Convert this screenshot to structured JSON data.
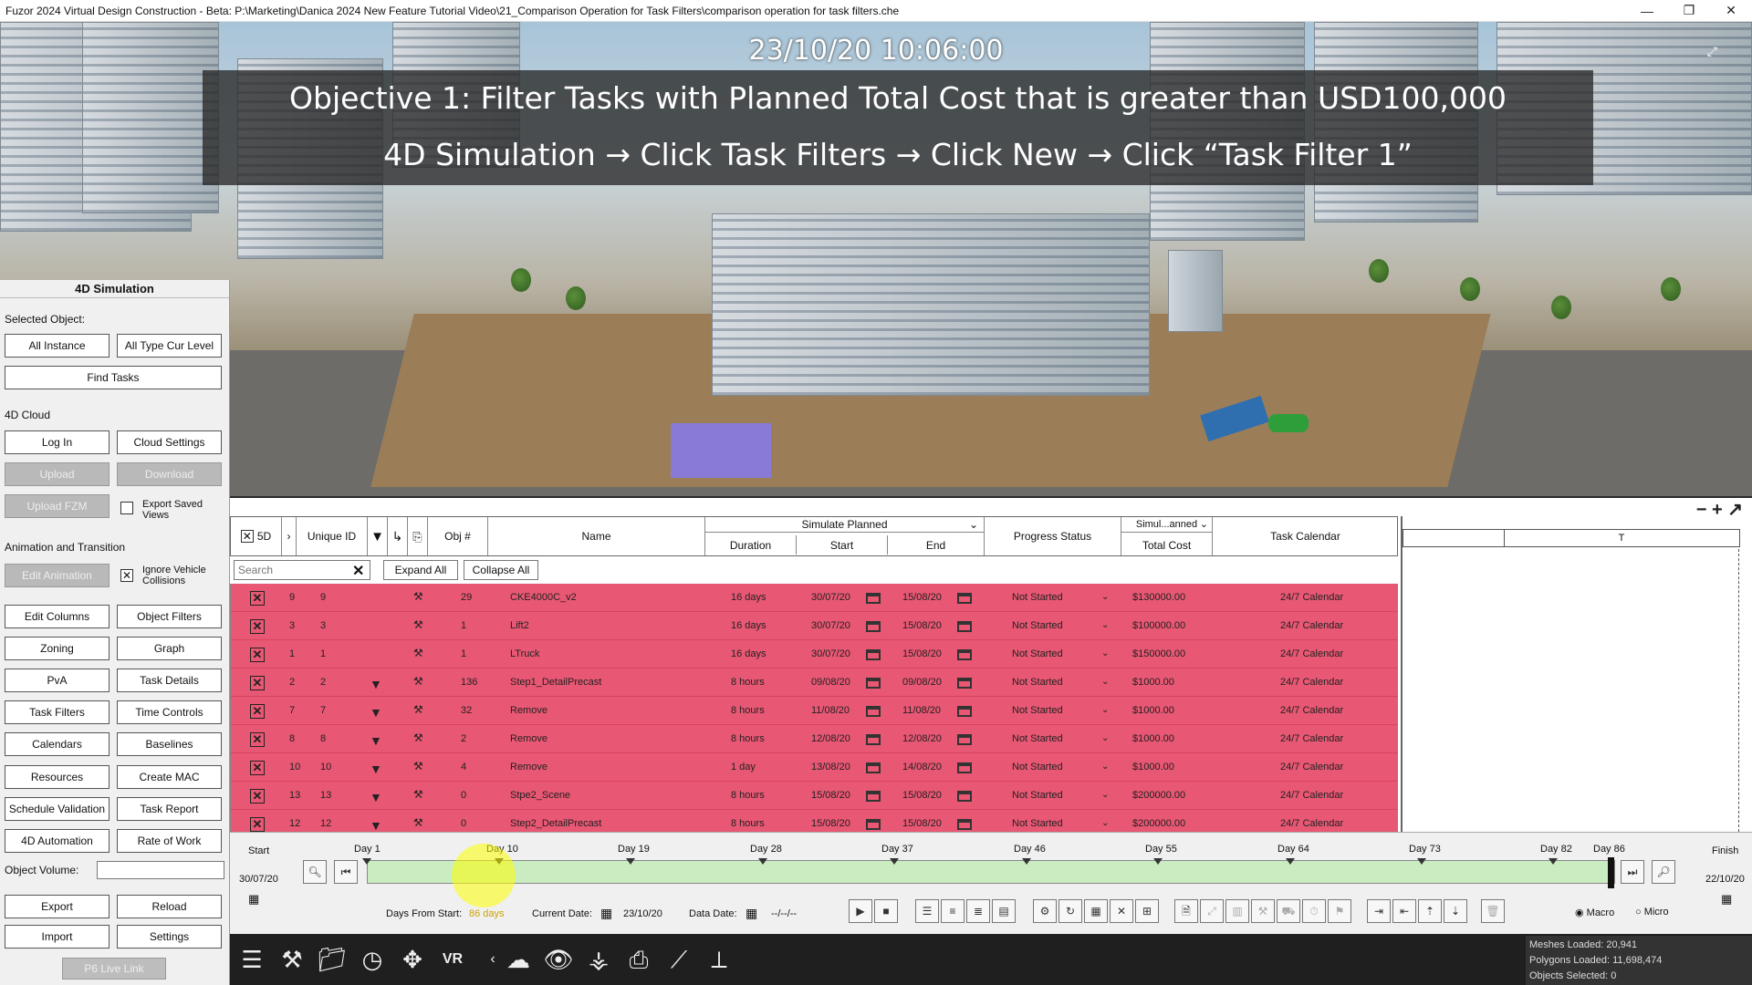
{
  "window": {
    "title": "Fuzor 2024 Virtual Design Construction - Beta: P:\\Marketing\\Danica 2024 New Feature Tutorial Video\\21_Comparison Operation for Task Filters\\comparison operation for task filters.che",
    "min": "—",
    "max": "❐",
    "close": "✕"
  },
  "viewport": {
    "datetime": "23/10/20 10:06:00",
    "banner_line1": "Objective 1: Filter Tasks with Planned Total Cost that is greater than USD100,000",
    "banner_line2": "4D Simulation →  Click Task Filters → Click New → Click “Task Filter 1”"
  },
  "panel": {
    "title": "4D Simulation",
    "selected_object": "Selected Object:",
    "all_instance": "All Instance",
    "all_type_cur_level": "All Type Cur Level",
    "find_tasks": "Find Tasks",
    "cloud_label": "4D Cloud",
    "log_in": "Log In",
    "cloud_settings": "Cloud Settings",
    "upload": "Upload",
    "download": "Download",
    "upload_fzm": "Upload FZM",
    "export_saved_views_1": "Export Saved",
    "export_saved_views_2": "Views",
    "anim_label": "Animation and Transition",
    "edit_animation": "Edit Animation",
    "ignore_vehicle_1": "Ignore Vehicle",
    "ignore_vehicle_2": "Collisions",
    "edit_columns": "Edit Columns",
    "object_filters": "Object Filters",
    "zoning": "Zoning",
    "graph": "Graph",
    "pva": "PvA",
    "task_details": "Task Details",
    "task_filters": "Task Filters",
    "time_controls": "Time Controls",
    "calendars": "Calendars",
    "baselines": "Baselines",
    "resources": "Resources",
    "create_mac": "Create MAC",
    "schedule_validation": "Schedule Validation",
    "task_report": "Task Report",
    "automation": "4D Automation",
    "rate_of_work": "Rate of Work",
    "object_volume": "Object Volume:",
    "export": "Export",
    "reload": "Reload",
    "import": "Import",
    "settings": "Settings",
    "p6_live_link": "P6 Live Link"
  },
  "table": {
    "headers": {
      "sd": "5D",
      "unique_id": "Unique ID",
      "obj": "Obj #",
      "name": "Name",
      "simulate": "Simulate Planned",
      "duration": "Duration",
      "start": "Start",
      "end": "End",
      "progress": "Progress Status",
      "simul_planned": "Simul...anned",
      "total_cost": "Total Cost",
      "task_calendar": "Task Calendar",
      "gantt_t": "T"
    },
    "search_placeholder": "Search",
    "expand_all": "Expand All",
    "collapse_all": "Collapse All",
    "rows": [
      {
        "a": "9",
        "uid": "9",
        "filter": false,
        "obj": "29",
        "name": "CKE4000C_v2",
        "duration": "16 days",
        "start": "30/07/20",
        "end": "15/08/20",
        "status": "Not Started",
        "cost": "$130000.00",
        "calendar": "24/7 Calendar"
      },
      {
        "a": "3",
        "uid": "3",
        "filter": false,
        "obj": "1",
        "name": "Lift2",
        "duration": "16 days",
        "start": "30/07/20",
        "end": "15/08/20",
        "status": "Not Started",
        "cost": "$100000.00",
        "calendar": "24/7 Calendar"
      },
      {
        "a": "1",
        "uid": "1",
        "filter": false,
        "obj": "1",
        "name": "LTruck",
        "duration": "16 days",
        "start": "30/07/20",
        "end": "15/08/20",
        "status": "Not Started",
        "cost": "$150000.00",
        "calendar": "24/7 Calendar"
      },
      {
        "a": "2",
        "uid": "2",
        "filter": true,
        "obj": "136",
        "name": "Step1_DetailPrecast",
        "duration": "8 hours",
        "start": "09/08/20",
        "end": "09/08/20",
        "status": "Not Started",
        "cost": "$1000.00",
        "calendar": "24/7 Calendar"
      },
      {
        "a": "7",
        "uid": "7",
        "filter": true,
        "obj": "32",
        "name": "Remove",
        "duration": "8 hours",
        "start": "11/08/20",
        "end": "11/08/20",
        "status": "Not Started",
        "cost": "$1000.00",
        "calendar": "24/7 Calendar"
      },
      {
        "a": "8",
        "uid": "8",
        "filter": true,
        "obj": "2",
        "name": "Remove",
        "duration": "8 hours",
        "start": "12/08/20",
        "end": "12/08/20",
        "status": "Not Started",
        "cost": "$1000.00",
        "calendar": "24/7 Calendar"
      },
      {
        "a": "10",
        "uid": "10",
        "filter": true,
        "obj": "4",
        "name": "Remove",
        "duration": "1 day",
        "start": "13/08/20",
        "end": "14/08/20",
        "status": "Not Started",
        "cost": "$1000.00",
        "calendar": "24/7 Calendar"
      },
      {
        "a": "13",
        "uid": "13",
        "filter": true,
        "obj": "0",
        "name": "Stpe2_Scene",
        "duration": "8 hours",
        "start": "15/08/20",
        "end": "15/08/20",
        "status": "Not Started",
        "cost": "$200000.00",
        "calendar": "24/7 Calendar"
      },
      {
        "a": "12",
        "uid": "12",
        "filter": true,
        "obj": "0",
        "name": "Step2_DetailPrecast",
        "duration": "8 hours",
        "start": "15/08/20",
        "end": "15/08/20",
        "status": "Not Started",
        "cost": "$200000.00",
        "calendar": "24/7 Calendar"
      }
    ]
  },
  "timeline": {
    "start_label": "Start",
    "finish_label": "Finish",
    "start_date": "30/07/20",
    "finish_date": "22/10/20",
    "days": [
      "Day 1",
      "Day 10",
      "Day 19",
      "Day 28",
      "Day 37",
      "Day 46",
      "Day 55",
      "Day 64",
      "Day 73",
      "Day 82",
      "Day 86"
    ],
    "days_from_start_label": "Days From Start:",
    "days_from_start": "86 days",
    "current_date_label": "Current Date:",
    "current_date": "23/10/20",
    "data_date_label": "Data Date:",
    "data_date": "--/--/--",
    "macro": "Macro",
    "micro": "Micro"
  },
  "stats": {
    "meshes": "Meshes Loaded: 20,941",
    "polygons": "Polygons Loaded: 11,698,474",
    "objects": "Objects Selected: 0"
  },
  "colors": {
    "row_highlight": "#e85773",
    "timeline_track": "#c9ecc0",
    "bottom_bar": "#1f1f1f"
  }
}
